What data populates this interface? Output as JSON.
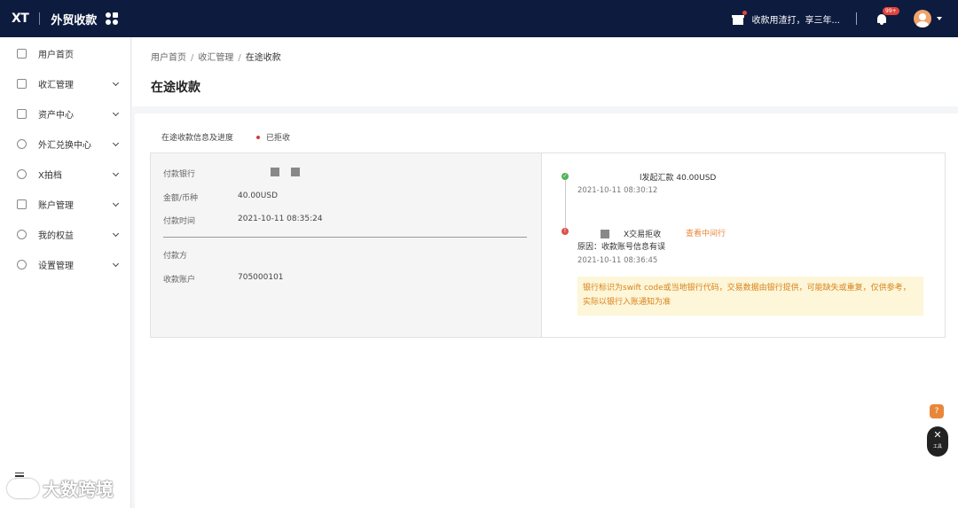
{
  "topbar": {
    "logo": "XT",
    "brand": "外贸收款",
    "promo": "收款用渣打，享三年...",
    "notification_badge": "99+"
  },
  "sidebar": {
    "items": [
      {
        "label": "用户首页",
        "icon": "home-icon",
        "expandable": false
      },
      {
        "label": "收汇管理",
        "icon": "receive-icon",
        "expandable": true
      },
      {
        "label": "资产中心",
        "icon": "wallet-icon",
        "expandable": true
      },
      {
        "label": "外汇兑换中心",
        "icon": "exchange-icon",
        "expandable": true
      },
      {
        "label": "X拍档",
        "icon": "partner-icon",
        "expandable": true
      },
      {
        "label": "账户管理",
        "icon": "account-icon",
        "expandable": true
      },
      {
        "label": "我的权益",
        "icon": "user-icon",
        "expandable": true
      },
      {
        "label": "设置管理",
        "icon": "settings-icon",
        "expandable": true
      }
    ],
    "watermark": "大数跨境"
  },
  "breadcrumb": [
    "用户首页",
    "收汇管理",
    "在途收款"
  ],
  "page_title": "在途收款",
  "section": {
    "title": "在途收款信息及进度",
    "status": "已拒收"
  },
  "payment_info": {
    "bank_label": "付款银行",
    "amount_label": "金额/币种",
    "amount_value": "40.00USD",
    "time_label": "付款时间",
    "time_value": "2021-10-11 08:35:24",
    "payer_label": "付款方",
    "account_label": "收款账户",
    "account_value": "705000101"
  },
  "timeline": {
    "step1_text": "l发起汇款 40.00USD",
    "step1_time": "2021-10-11 08:30:12",
    "step2_text": "X交易拒收",
    "step2_link": "查看中间行",
    "step2_reason": "原因：收款账号信息有误",
    "step2_time": "2021-10-11 08:36:45",
    "notice": "银行标识为swift code或当地银行代码，交易数据由银行提供，可能缺失或重复，仅供参考，实际以银行入账通知为准"
  },
  "tools": {
    "help": "?",
    "tools_label": "工具"
  }
}
